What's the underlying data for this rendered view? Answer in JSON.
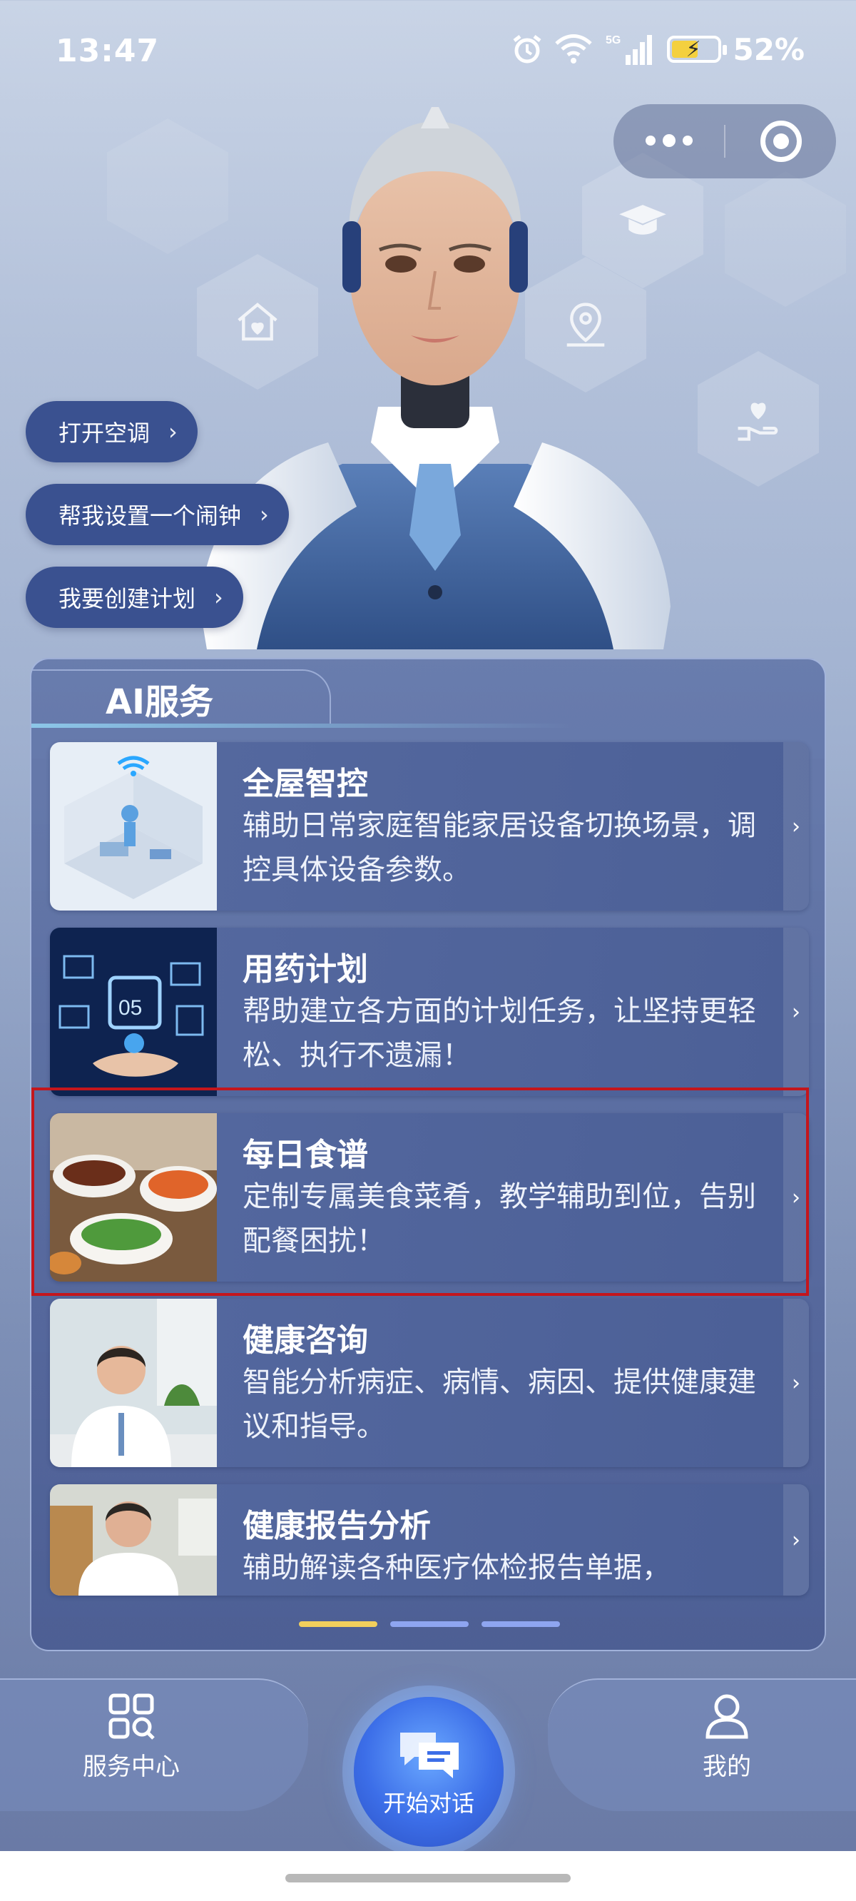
{
  "status_bar": {
    "time": "13:47",
    "network": "5G",
    "battery": "52%",
    "icons": [
      "alarm-icon",
      "wifi-icon",
      "signal-icon",
      "battery-icon"
    ]
  },
  "capsule": {
    "more_icon": "more-dots-icon",
    "close_icon": "target-close-icon"
  },
  "quick_actions": [
    {
      "label": "打开空调"
    },
    {
      "label": "帮我设置一个闹钟"
    },
    {
      "label": "我要创建计划"
    }
  ],
  "services": {
    "title": "AI服务",
    "cards": [
      {
        "title": "全屋智控",
        "desc": "辅助日常家庭智能家居设备切换场景，调控具体设备参数。"
      },
      {
        "title": "用药计划",
        "desc": "帮助建立各方面的计划任务，让坚持更轻松、执行不遗漏！"
      },
      {
        "title": "每日食谱",
        "desc": "定制专属美食菜肴，教学辅助到位，告别配餐困扰！"
      },
      {
        "title": "健康咨询",
        "desc": "智能分析病症、病情、病因、提供健康建议和指导。"
      },
      {
        "title": "健康报告分析",
        "desc": "辅助解读各种医疗体检报告单据，"
      }
    ],
    "pager_active": 1
  },
  "bottom_nav": {
    "left": "服务中心",
    "center": "开始对话",
    "right": "我的"
  },
  "colors": {
    "chip_bg": "#3a5190",
    "accent_yellow": "#f1cf5c",
    "highlight_red": "#c4161c"
  }
}
